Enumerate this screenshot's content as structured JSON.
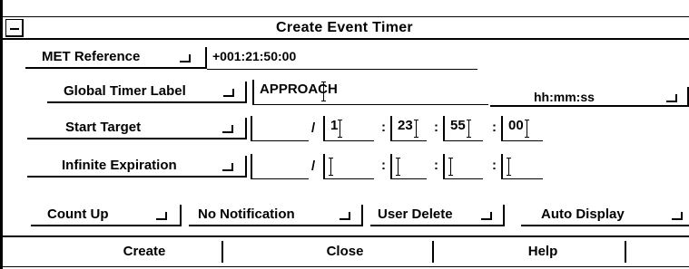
{
  "window": {
    "title": "Create Event Timer"
  },
  "met": {
    "menu_label": "MET Reference",
    "value": "+001:21:50:00"
  },
  "label_row": {
    "menu_label": "Global Timer Label",
    "value": "APPROACH",
    "format": "hh:mm:ss"
  },
  "start_row": {
    "menu_label": "Start Target",
    "day": "",
    "sep_slash": "/",
    "d": "1",
    "hh": "23",
    "mm": "55",
    "ss": "00",
    "sep_colon": ":"
  },
  "expire_row": {
    "menu_label": "Infinite Expiration",
    "day": "",
    "sep_slash": "/",
    "d": "",
    "hh": "",
    "mm": "",
    "ss": "",
    "sep_colon": ":"
  },
  "options": {
    "count": "Count Up",
    "notify": "No Notification",
    "delete": "User Delete",
    "display": "Auto Display"
  },
  "buttons": {
    "create": "Create",
    "close": "Close",
    "help": "Help"
  }
}
